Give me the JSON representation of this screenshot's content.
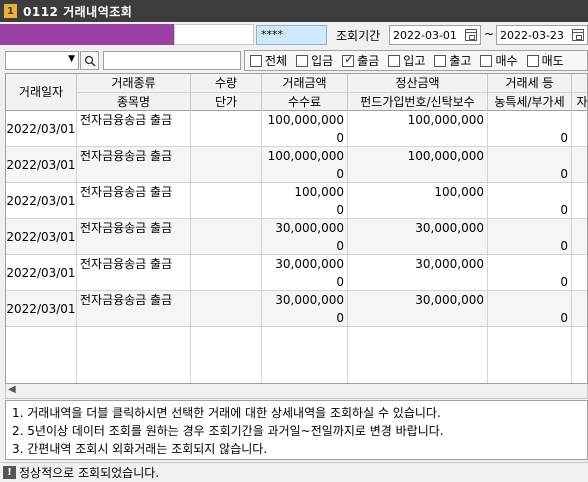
{
  "window": {
    "number": "1",
    "title": "0112 거래내역조회"
  },
  "query": {
    "password_mask": "****",
    "period_label": "조회기간",
    "start_date": "2022-03-01",
    "separator": "~",
    "end_date": "2022-03-23"
  },
  "filters": [
    {
      "label": "전체",
      "checked": false
    },
    {
      "label": "입금",
      "checked": false
    },
    {
      "label": "출금",
      "checked": true
    },
    {
      "label": "입고",
      "checked": false
    },
    {
      "label": "출고",
      "checked": false
    },
    {
      "label": "매수",
      "checked": false
    },
    {
      "label": "매도",
      "checked": false
    }
  ],
  "table": {
    "headers": {
      "date": "거래일자",
      "type_top": "거래종류",
      "type_bottom": "종목명",
      "qty_top": "수량",
      "qty_bottom": "단가",
      "amount_top": "거래금액",
      "amount_bottom": "수수료",
      "settle_top": "정산금액",
      "settle_bottom": "펀드가입번호/신탁보수",
      "tax_top": "거래세 등",
      "tax_bottom": "농특세/부가세",
      "extra_bottom": "자"
    },
    "rows": [
      {
        "date": "2022/03/01",
        "type": "전자금융송금 출금",
        "amount": "100,000,000",
        "fee": "0",
        "settle": "100,000,000",
        "tax": "0"
      },
      {
        "date": "2022/03/01",
        "type": "전자금융송금 출금",
        "amount": "100,000,000",
        "fee": "0",
        "settle": "100,000,000",
        "tax": "0"
      },
      {
        "date": "2022/03/01",
        "type": "전자금융송금 출금",
        "amount": "100,000",
        "fee": "0",
        "settle": "100,000",
        "tax": "0"
      },
      {
        "date": "2022/03/01",
        "type": "전자금융송금 출금",
        "amount": "30,000,000",
        "fee": "0",
        "settle": "30,000,000",
        "tax": "0"
      },
      {
        "date": "2022/03/01",
        "type": "전자금융송금 출금",
        "amount": "30,000,000",
        "fee": "0",
        "settle": "30,000,000",
        "tax": "0"
      },
      {
        "date": "2022/03/01",
        "type": "전자금융송금 출금",
        "amount": "30,000,000",
        "fee": "0",
        "settle": "30,000,000",
        "tax": "0"
      }
    ]
  },
  "notes": [
    "1. 거래내역을 더블 클릭하시면 선택한 거래에 대한 상세내역을 조회하실 수 있습니다.",
    "2. 5년이상 데이터 조회를 원하는 경우 조회기간을 과거일~전일까지로 변경 바랍니다.",
    "3. 간편내역 조회시 외화거래는 조회되지 않습니다."
  ],
  "status": {
    "icon": "!",
    "message": "정상적으로 조회되었습니다."
  },
  "colors": {
    "account_bar": "#9b3fa5",
    "password_bg": "#cfe8fb",
    "titlebar": "#3c3c3c"
  }
}
